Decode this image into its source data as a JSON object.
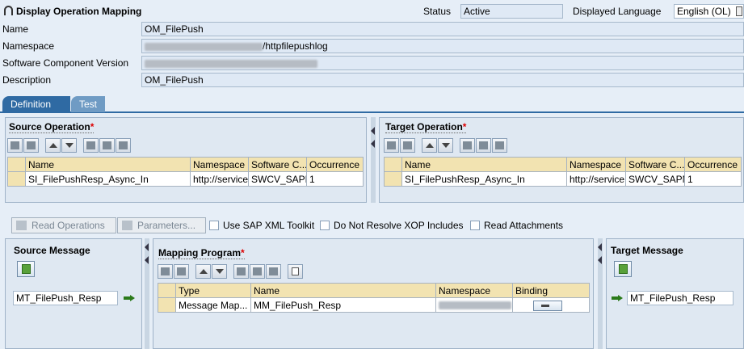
{
  "header": {
    "title": "Display Operation Mapping",
    "status_label": "Status",
    "status_value": "Active",
    "language_label": "Displayed Language",
    "language_value": "English (OL)"
  },
  "form": {
    "name_label": "Name",
    "name_value": "OM_FilePush",
    "namespace_label": "Namespace",
    "namespace_value": "/httpfilepushlog",
    "swcv_label": "Software Component Version",
    "description_label": "Description",
    "description_value": "OM_FilePush"
  },
  "tabs": [
    {
      "label": "Definition"
    },
    {
      "label": "Test"
    }
  ],
  "source_operation": {
    "title": "Source Operation",
    "columns": [
      "Name",
      "Namespace",
      "Software C...",
      "Occurrence"
    ],
    "row": [
      "SI_FilePushResp_Async_In",
      "http://service.",
      "SWCV_SAPM",
      "1"
    ]
  },
  "target_operation": {
    "title": "Target Operation",
    "columns": [
      "Name",
      "Namespace",
      "Software C...",
      "Occurrence"
    ],
    "row": [
      "SI_FilePushResp_Async_In",
      "http://service.",
      "SWCV_SAPM",
      "1"
    ]
  },
  "actions": {
    "read_operations": "Read Operations",
    "parameters": "Parameters...",
    "use_sap_xml_toolkit": "Use SAP XML Toolkit",
    "do_not_resolve_xop": "Do Not Resolve XOP Includes",
    "read_attachments": "Read Attachments"
  },
  "source_message": {
    "title": "Source Message",
    "value": "MT_FilePush_Resp"
  },
  "mapping_program": {
    "title": "Mapping Program",
    "columns": [
      "Type",
      "Name",
      "Namespace",
      "Binding"
    ],
    "row": [
      "Message Map...",
      "MM_FilePush_Resp",
      "",
      ""
    ]
  },
  "target_message": {
    "title": "Target Message",
    "value": "MT_FilePush_Resp"
  },
  "colors": {
    "tab_active": "#2f6aa3",
    "tab_inactive": "#6f9bc4",
    "header_cell": "#f2e3b1",
    "required": "#dd0000"
  }
}
